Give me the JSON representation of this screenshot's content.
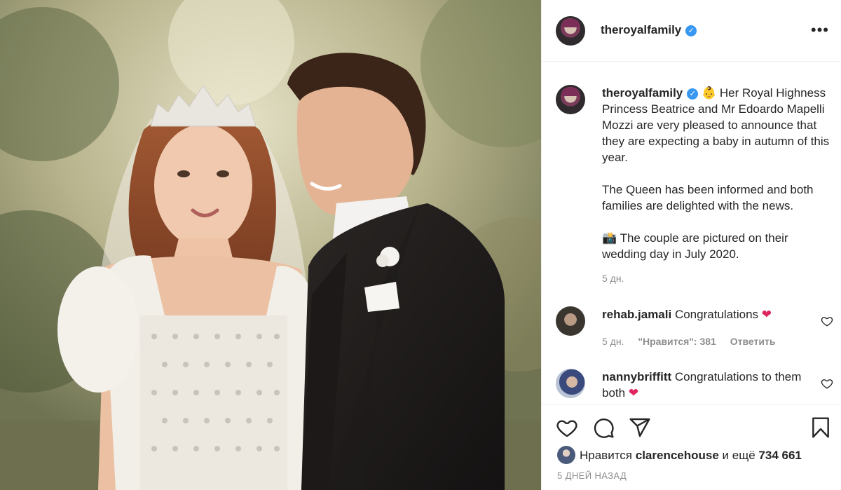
{
  "photo": {
    "alt_subject": "wedding-portrait"
  },
  "header": {
    "username": "theroyalfamily",
    "verified_icon": "✓",
    "more_icon": "•••"
  },
  "caption": {
    "username": "theroyalfamily",
    "emoji": "👶",
    "text": "Her Royal Highness Princess Beatrice and Mr Edoardo Mapelli Mozzi are very pleased to announce that they are expecting a baby in autumn of this year.\n\nThe Queen has been informed and both families are delighted with the news.\n\n📸 The couple are pictured on their wedding day in July 2020.",
    "time": "5 дн."
  },
  "comments": [
    {
      "username": "rehab.jamali",
      "text": "Congratulations ❤️",
      "time": "5 дн.",
      "likes": "\"Нравится\": 381",
      "reply": "Ответить"
    },
    {
      "username": "nannybriffitt",
      "text": "Congratulations to them both ❤️"
    }
  ],
  "actions": {
    "likes_prefix": "Нравится",
    "likes_user": "clarencehouse",
    "likes_middle": "и ещё",
    "likes_count": "734 661",
    "posted": "5 ДНЕЙ НАЗАД"
  },
  "colors": {
    "accent_blue": "#3897f0",
    "text": "#262626",
    "muted": "#8e8e8e",
    "heart_red": "#e0245e"
  }
}
